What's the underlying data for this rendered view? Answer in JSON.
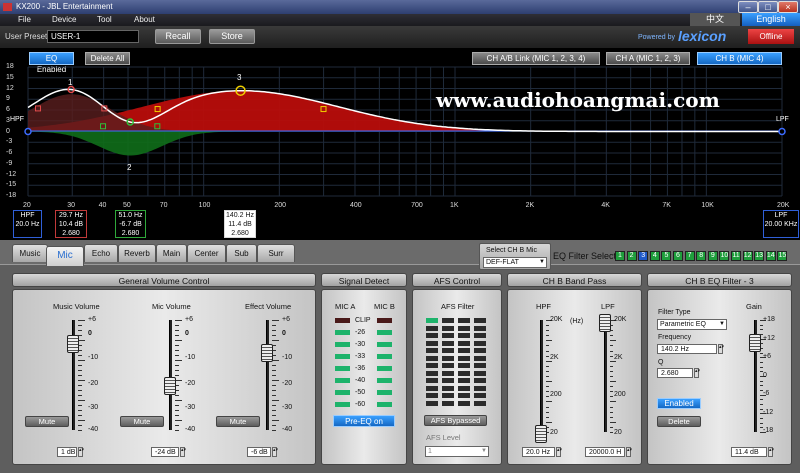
{
  "window": {
    "title": "KX200 - JBL Entertainment"
  },
  "menu": [
    "File",
    "Device",
    "Tool",
    "About"
  ],
  "lang": {
    "chinese": "中文",
    "english": "English"
  },
  "preset": {
    "label": "User Preset",
    "value": "USER-1",
    "recall": "Recall",
    "store": "Store",
    "branding": "Powered by",
    "brand": "lexicon",
    "offline": "Offline"
  },
  "eq_controls": {
    "eq_enabled": "EQ Enabled",
    "delete_all": "Delete All",
    "ch_ab_link": "CH A/B Link (MIC 1, 2, 3, 4)",
    "ch_a": "CH A (MIC 1, 2, 3)",
    "ch_b": "CH B (MIC 4)"
  },
  "watermark": "www.audiohoangmai.com",
  "graph": {
    "y_ticks": [
      "18",
      "15",
      "12",
      "9",
      "6",
      "3",
      "0",
      "-3",
      "-6",
      "-9",
      "-12",
      "-15",
      "-18"
    ],
    "x_ticks": [
      "20",
      "30",
      "40",
      "50",
      "70",
      "100",
      "200",
      "400",
      "700",
      "1K",
      "2K",
      "4K",
      "7K",
      "10K",
      "20K"
    ],
    "hpf_label": "HPF",
    "lpf_label": "LPF",
    "markers": [
      "1",
      "2",
      "3"
    ],
    "colors": {
      "fill_red": "#c0100e",
      "fill_green": "#0f6e1a",
      "curve": "#ffffff",
      "grid": "#1f2a3a"
    }
  },
  "eq_boxes": [
    {
      "l1": "HPF",
      "l2": "20.0 Hz",
      "l3": "",
      "color": "#2f5fd8"
    },
    {
      "l1": "29.7 Hz",
      "l2": "10.4 dB",
      "l3": "2.680",
      "color": "#c23a3a"
    },
    {
      "l1": "51.0 Hz",
      "l2": "-6.7 dB",
      "l3": "2.680",
      "color": "#2fa83a"
    },
    {
      "l1": "140.2 Hz",
      "l2": "11.4 dB",
      "l3": "2.680",
      "color": "#d8d8d8"
    },
    {
      "l1": "LPF",
      "l2": "20.00 KHz",
      "l3": "",
      "color": "#2f5fd8"
    }
  ],
  "tabs": [
    "Music",
    "Mic",
    "Echo",
    "Reverb",
    "Main",
    "Center",
    "Sub",
    "Surr"
  ],
  "ch_select": {
    "label": "Select CH B Mic",
    "value": "DEF-FLAT"
  },
  "filter_select": {
    "label": "EQ Filter Select",
    "buttons": [
      "1",
      "2",
      "3",
      "4",
      "5",
      "6",
      "7",
      "8",
      "9",
      "10",
      "11",
      "12",
      "13",
      "14",
      "15"
    ],
    "active": 3
  },
  "panels": {
    "general_volume": "General Volume Control",
    "signal_detect": "Signal Detect",
    "afs_control": "AFS Control",
    "band_pass": "CH B Band Pass",
    "eq_filter": "CH B EQ Filter - 3"
  },
  "volume": {
    "music": {
      "label": "Music Volume",
      "value": "1 dB",
      "level": 0.78
    },
    "mic": {
      "label": "Mic Volume",
      "value": "-24 dB",
      "level": 0.4
    },
    "effect": {
      "label": "Effect Volume",
      "value": "-6 dB",
      "level": 0.7
    },
    "scale": [
      "+6",
      "0",
      "-10",
      "-20",
      "-30",
      "-40"
    ],
    "mute": "Mute"
  },
  "signal": {
    "mic_a": "MIC A",
    "mic_b": "MIC B",
    "levels": [
      "CLIP",
      "-26",
      "-30",
      "-33",
      "-36",
      "-40",
      "-50",
      "-60"
    ],
    "pre_eq": "Pre-EQ on"
  },
  "afs": {
    "label": "AFS Filter",
    "bypass": "AFS Bypassed",
    "level_label": "AFS Level",
    "level_value": "1"
  },
  "bandpass": {
    "hpf": "HPF",
    "lpf": "LPF",
    "unit": "(Hz)",
    "scale": [
      "20K",
      "2K",
      "200",
      "20"
    ],
    "hpf_value": "20.0 Hz",
    "lpf_value": "20000.0 H"
  },
  "eqfilter": {
    "type_label": "Filter Type",
    "type_value": "Parametric EQ",
    "freq_label": "Frequency",
    "freq_value": "140.2 Hz",
    "q_label": "Q",
    "q_value": "2.680",
    "enabled": "Enabled",
    "delete": "Delete",
    "gain_label": "Gain",
    "gain_scale": [
      "+18",
      "+12",
      "+6",
      "0",
      "-6",
      "-12",
      "-18"
    ],
    "gain_value": "11.4 dB"
  }
}
